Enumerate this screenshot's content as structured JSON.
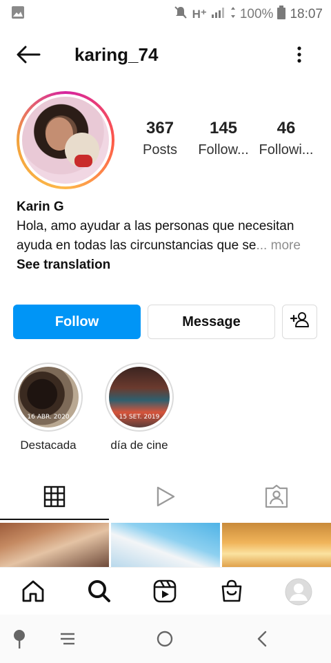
{
  "status_bar": {
    "network": "H⁺",
    "battery": "100%",
    "time": "18:07",
    "icons": [
      "gallery-icon",
      "mute-icon",
      "signal-icon",
      "data-arrows-icon",
      "battery-icon"
    ]
  },
  "header": {
    "username": "karing_74",
    "icons": [
      "back-arrow-icon",
      "more-vertical-icon"
    ]
  },
  "profile": {
    "stats": [
      {
        "value": "367",
        "label": "Posts"
      },
      {
        "value": "145",
        "label": "Follow..."
      },
      {
        "value": "46",
        "label": "Followi..."
      }
    ],
    "name": "Karin G",
    "bio": "Hola, amo ayudar a las personas que necesitan ayuda en todas las circunstancias que se",
    "bio_more": "... more",
    "see_translation": "See translation"
  },
  "actions": {
    "follow": "Follow",
    "message": "Message",
    "add_user_icon": "add-user-icon"
  },
  "highlights": [
    {
      "label": "Destacada",
      "date": "16 ABR. 2020"
    },
    {
      "label": "día de cine",
      "date": "15 SET. 2019"
    }
  ],
  "tabs": [
    {
      "icon": "grid-icon",
      "active": true
    },
    {
      "icon": "reels-play-icon",
      "active": false
    },
    {
      "icon": "tagged-icon",
      "active": false
    }
  ],
  "bottom_nav": [
    "home-icon",
    "search-icon",
    "reels-icon",
    "shop-icon",
    "profile-avatar-icon"
  ],
  "system_nav": [
    "assistant-icon",
    "recent-apps-icon",
    "home-circle-icon",
    "back-chevron-icon"
  ],
  "colors": {
    "accent": "#0095f6",
    "border": "#dbdbdb",
    "muted_text": "#8e8e8e"
  }
}
